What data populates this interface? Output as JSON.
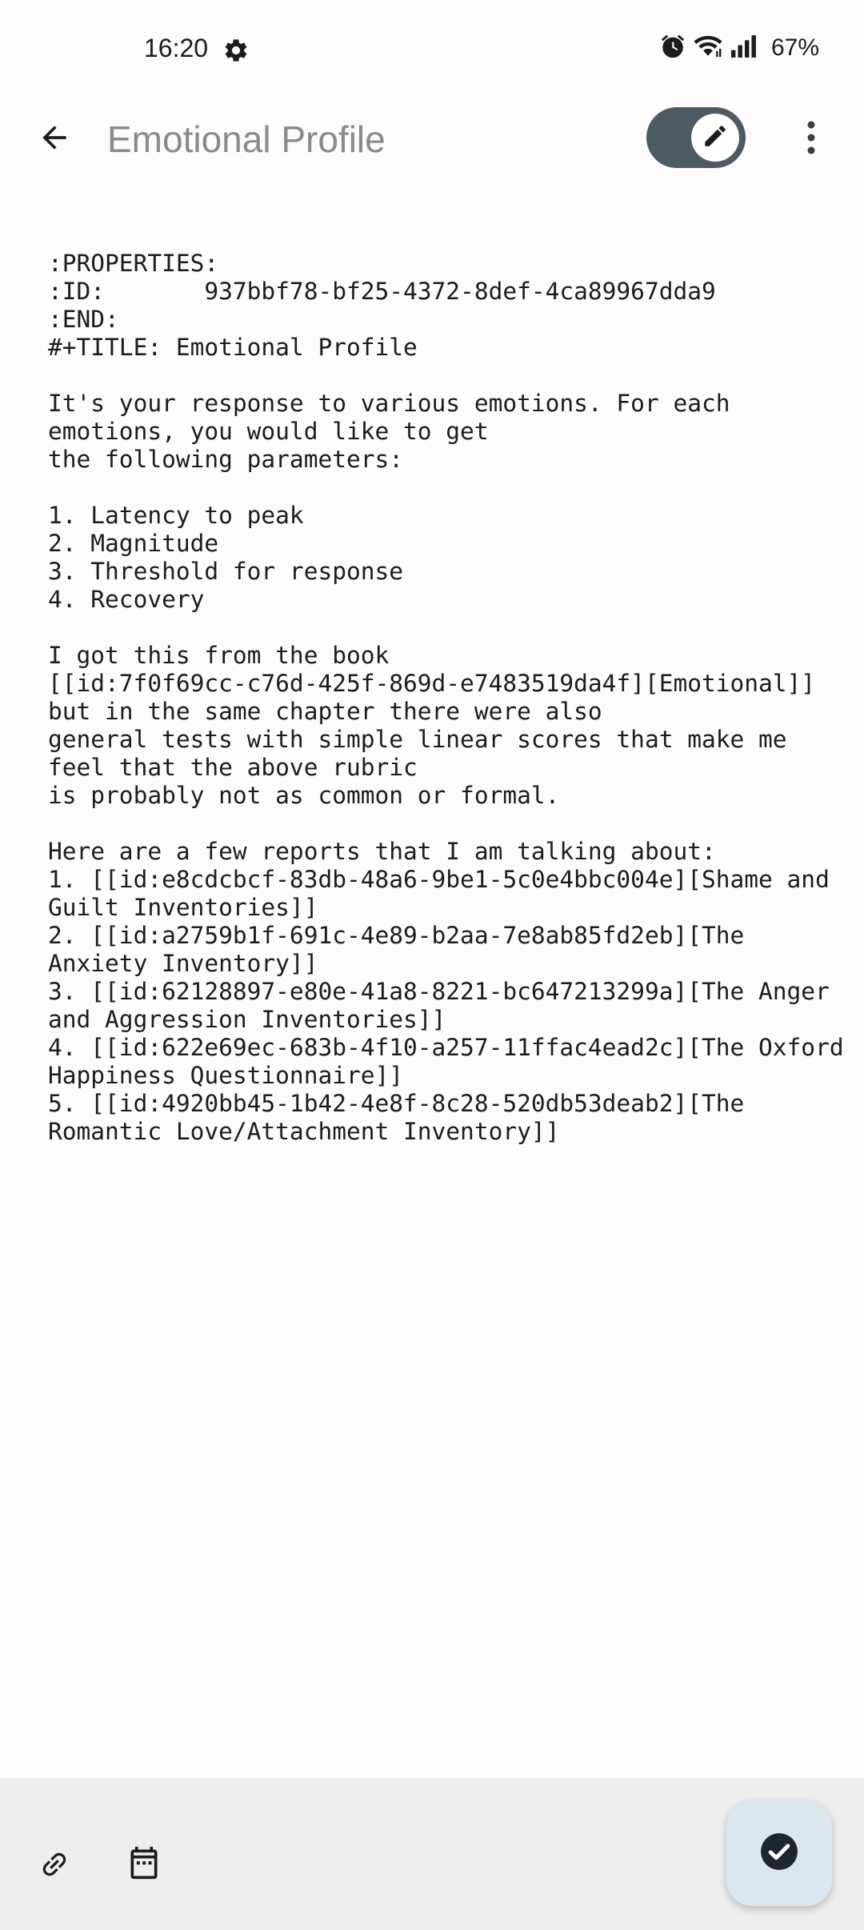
{
  "status_bar": {
    "time": "16:20",
    "battery": "67%",
    "icons": [
      "settings-gear-icon",
      "alarm-icon",
      "wifi-icon",
      "signal-icon"
    ]
  },
  "app_bar": {
    "title": "Emotional Profile",
    "back_icon": "arrow-back-icon",
    "edit_toggle_icon": "pencil-icon",
    "edit_toggle_on": true,
    "more_icon": "more-vert-icon"
  },
  "editor": {
    "lines": [
      ":PROPERTIES:",
      ":ID:       937bbf78-bf25-4372-8def-4ca89967dda9",
      ":END:",
      "#+TITLE: Emotional Profile",
      "",
      "It's your response to various emotions. For each",
      "emotions, you would like to get",
      "the following parameters:",
      "",
      "1. Latency to peak",
      "2. Magnitude",
      "3. Threshold for response",
      "4. Recovery",
      "",
      "I got this from the book",
      "[[id:7f0f69cc-c76d-425f-869d-e7483519da4f][Emotional]]",
      "but in the same chapter there were also",
      "general tests with simple linear scores that make me",
      "feel that the above rubric",
      "is probably not as common or formal.",
      "",
      "Here are a few reports that I am talking about:",
      "1. [[id:e8cdcbcf-83db-48a6-9be1-5c0e4bbc004e][Shame and",
      "Guilt Inventories]]",
      "2. [[id:a2759b1f-691c-4e89-b2aa-7e8ab85fd2eb][The",
      "Anxiety Inventory]]",
      "3. [[id:62128897-e80e-41a8-8221-bc647213299a][The Anger",
      "and Aggression Inventories]]",
      "4. [[id:622e69ec-683b-4f10-a257-11ffac4ead2c][The Oxford",
      "Happiness Questionnaire]]",
      "5. [[id:4920bb45-1b42-4e8f-8c28-520db53deab2][The",
      "Romantic Love/Attachment Inventory]]"
    ]
  },
  "bottom_bar": {
    "link_icon": "link-icon",
    "calendar_icon": "calendar-icon",
    "save_icon": "check-circle-icon"
  },
  "colors": {
    "background": "#fdfbfb",
    "toggle": "#4f5b62",
    "bottom_bar": "#efeeee",
    "fab": "#dce6ee",
    "title": "#8a8a8a"
  }
}
